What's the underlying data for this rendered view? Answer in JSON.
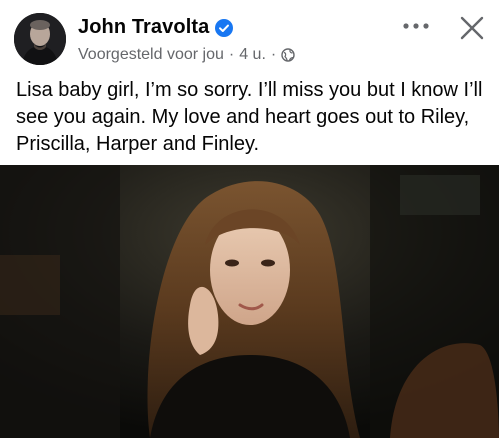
{
  "post": {
    "author": {
      "name": "John Travolta",
      "verified_icon": "verified-badge-icon",
      "avatar": "avatar"
    },
    "meta": {
      "label": "Voorgesteld voor jou",
      "separator": "·",
      "time": "4 u.",
      "audience_icon": "globe-icon"
    },
    "actions": {
      "more_label": "•••",
      "close_icon": "close-icon"
    },
    "text": "Lisa baby girl, I’m so sorry. I’ll miss you but I know I’ll see you again. My love and heart goes out to Riley, Priscilla, Harper and Finley.",
    "colors": {
      "verified": "#1877f2",
      "secondary_text": "#65676b",
      "primary_text": "#050505"
    }
  }
}
